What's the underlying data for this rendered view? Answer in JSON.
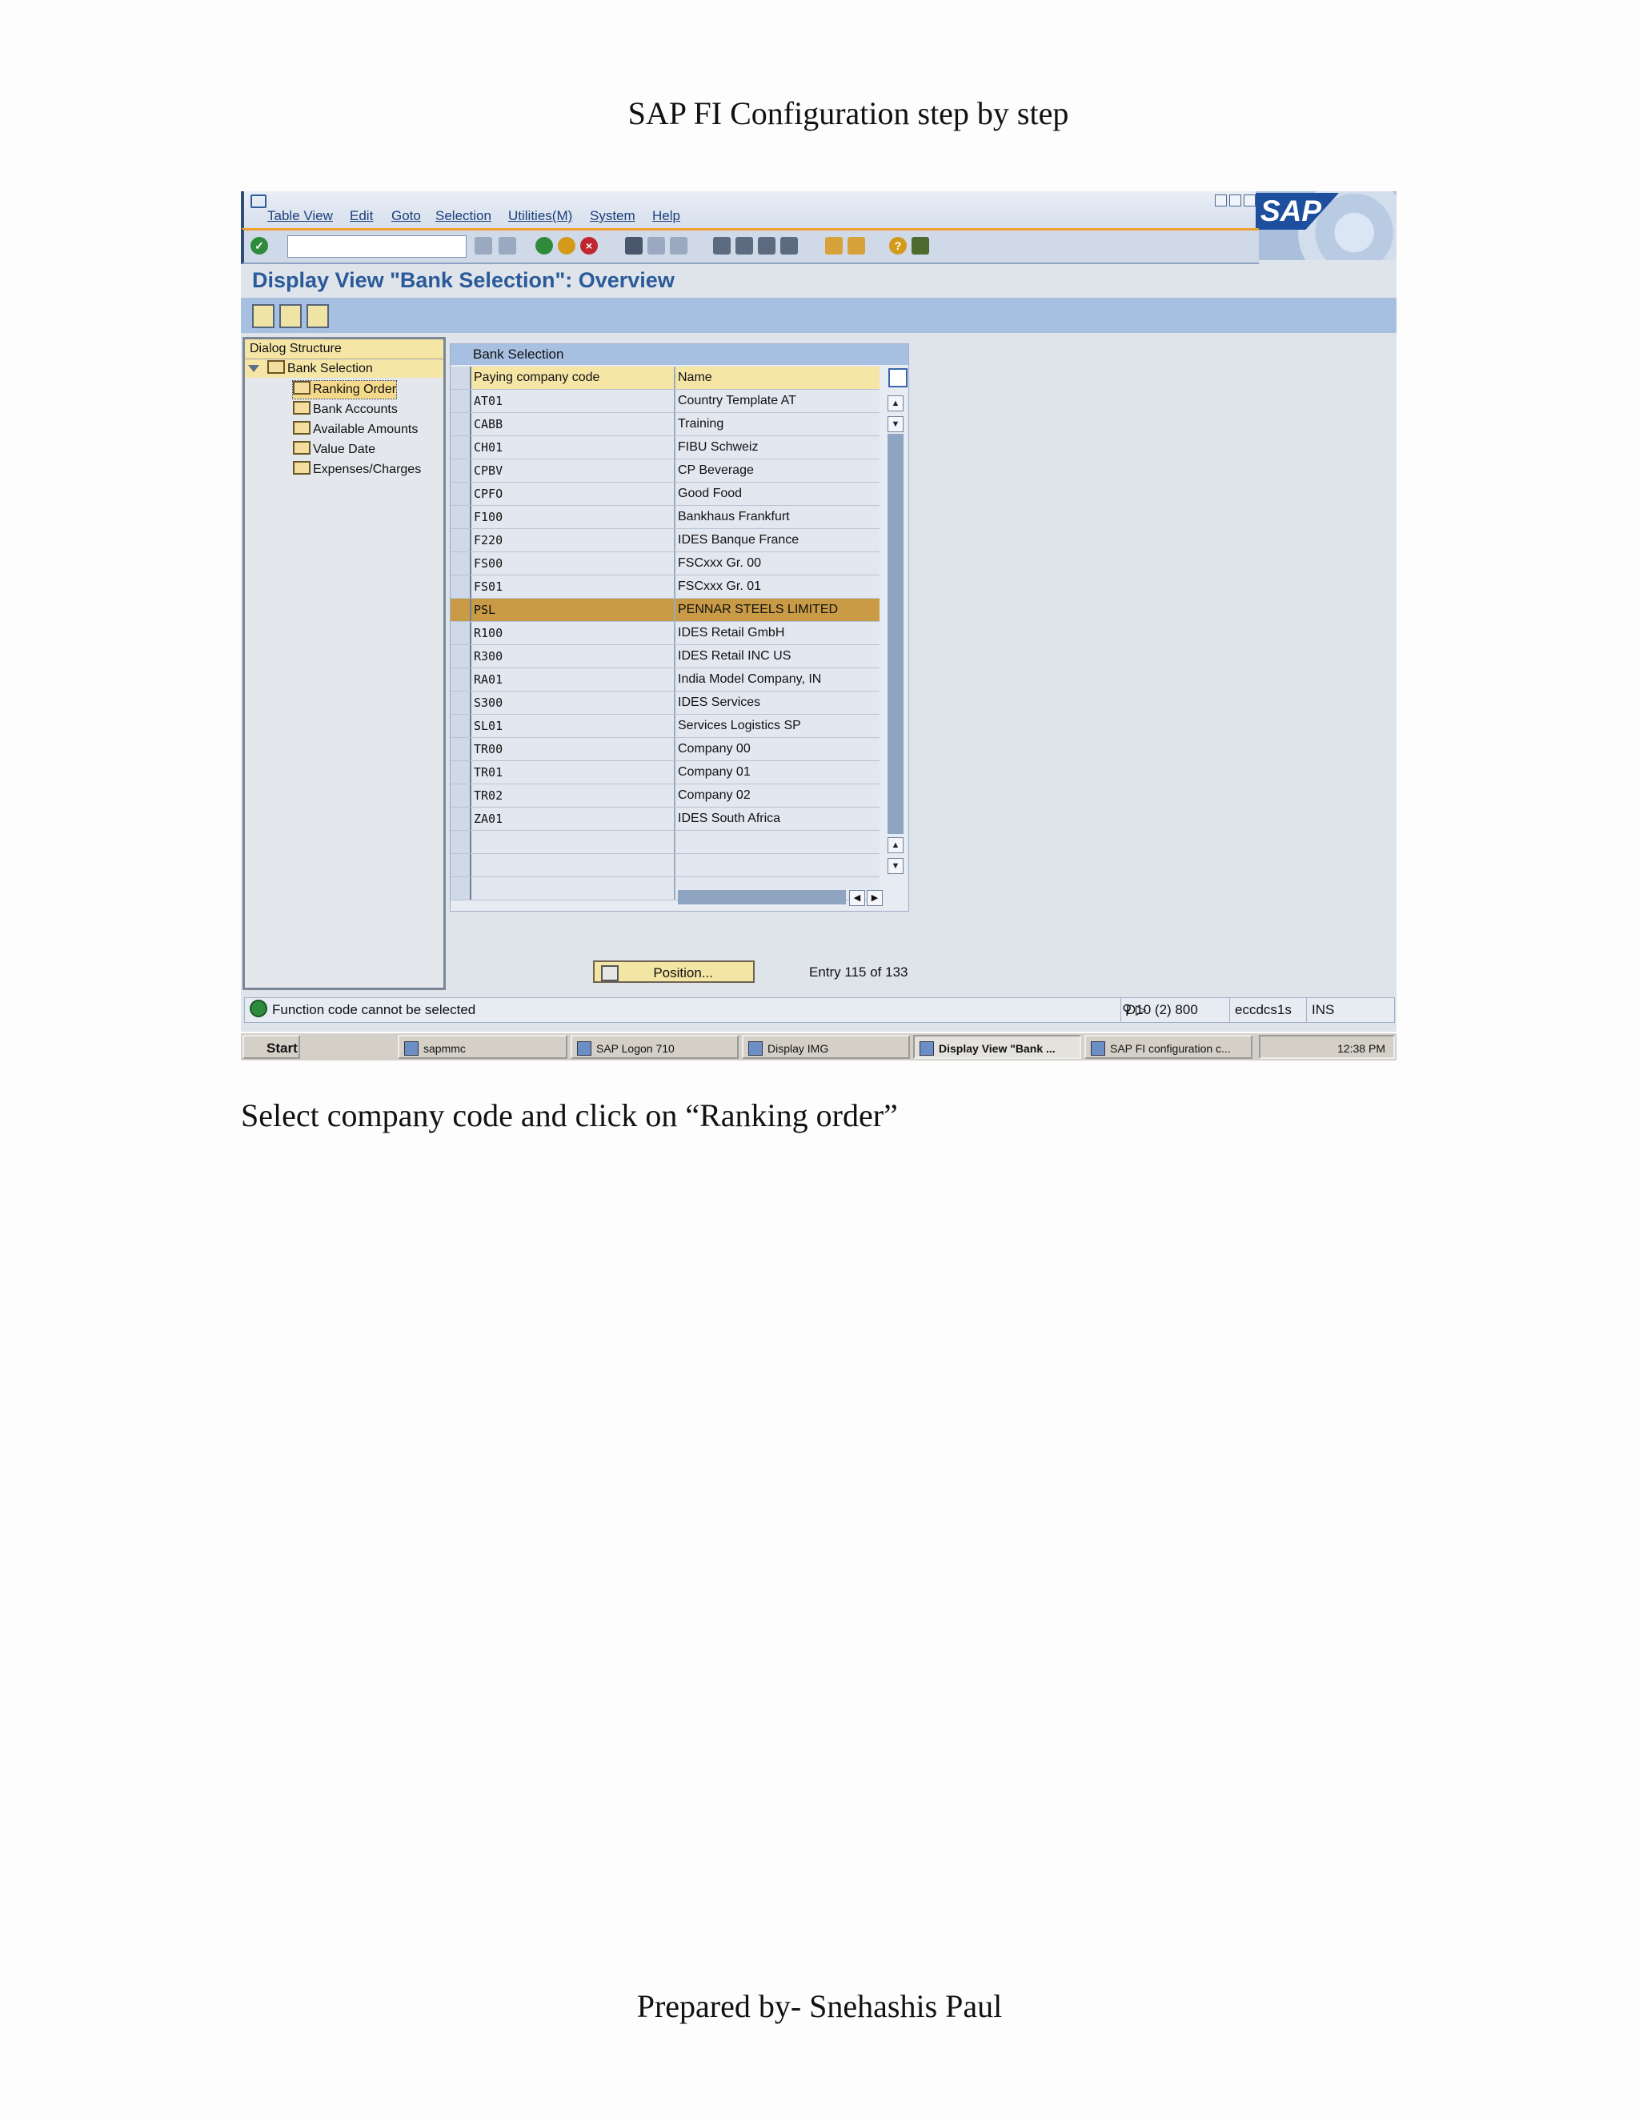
{
  "document": {
    "header_title": "SAP FI Configuration step by step",
    "caption": "Select company code and click on “Ranking order”",
    "footer": "Prepared by- Snehashis Paul"
  },
  "sap": {
    "menu": [
      "Table View",
      "Edit",
      "Goto",
      "Selection",
      "Utilities(M)",
      "System",
      "Help"
    ],
    "logo_text": "SAP",
    "page_title": "Display View \"Bank Selection\": Overview",
    "dialog_structure": {
      "title": "Dialog Structure",
      "root": "Bank Selection",
      "children": [
        "Ranking Order",
        "Bank Accounts",
        "Available Amounts",
        "Value Date",
        "Expenses/Charges"
      ]
    },
    "table": {
      "title": "Bank Selection",
      "headers": [
        "Paying company code",
        "Name"
      ],
      "rows": [
        [
          "AT01",
          "Country Template AT"
        ],
        [
          "CABB",
          "Training"
        ],
        [
          "CH01",
          "FIBU Schweiz"
        ],
        [
          "CPBV",
          "CP Beverage"
        ],
        [
          "CPFO",
          "Good Food"
        ],
        [
          "F100",
          "Bankhaus Frankfurt"
        ],
        [
          "F220",
          "IDES  Banque France"
        ],
        [
          "FS00",
          "FSCxxx Gr. 00"
        ],
        [
          "FS01",
          "FSCxxx Gr. 01"
        ],
        [
          "PSL",
          "PENNAR STEELS LIMITED"
        ],
        [
          "R100",
          "IDES Retail GmbH"
        ],
        [
          "R300",
          "IDES Retail INC US"
        ],
        [
          "RA01",
          "India Model Company, IN"
        ],
        [
          "S300",
          "IDES Services"
        ],
        [
          "SL01",
          "Services Logistics SP"
        ],
        [
          "TR00",
          "Company 00"
        ],
        [
          "TR01",
          "Company 01"
        ],
        [
          "TR02",
          "Company 02"
        ],
        [
          "ZA01",
          "IDES South Africa"
        ],
        [
          "",
          ""
        ],
        [
          "",
          ""
        ],
        [
          "",
          ""
        ]
      ],
      "selected_row_index": 9
    },
    "position_button": "Position...",
    "entry_text": "Entry 115 of 133",
    "status": {
      "message": "Function code cannot be selected",
      "system": "D10 (2) 800",
      "server": "eccdcs1s",
      "mode": "INS"
    },
    "taskbar": {
      "start": "Start",
      "tasks": [
        "sapmmc",
        "SAP Logon 710",
        "Display IMG",
        "Display View \"Bank ...",
        "SAP FI configuration c..."
      ],
      "active_task_index": 3,
      "clock": "12:38 PM"
    }
  }
}
